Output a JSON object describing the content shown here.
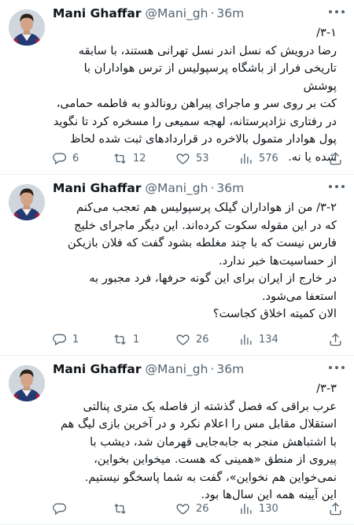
{
  "tweets": [
    {
      "author_name": "Mani Ghaffar",
      "handle": "@Mani_gh",
      "separator": "·",
      "time": "36m",
      "text": "۳-۱/\nرضا درویش که نسل اندر نسل تهرانی هستند، با سابقه\nتاریخی فرار از باشگاه پرسپولیس از ترس هواداران با پوشش\nکت بر روی سر و ماجرای پیراهن رونالدو به فاطمه حمامی،\nدر رفتاری نژادپرستانه، لهجه سمیعی را مسخره کرد تا نگوید\nپول هوادار متمول بالاخره در قراردادهای ثبت شده لحاظ\nشده یا نه.",
      "replies": "6",
      "retweets": "12",
      "likes": "53",
      "views": "576"
    },
    {
      "author_name": "Mani Ghaffar",
      "handle": "@Mani_gh",
      "separator": "·",
      "time": "36m",
      "text": "۳-۲/ من از هواداران گیلک پرسپولیس هم تعجب می‌کنم\nکه در این مقوله سکوت کرده‌اند. این دیگر ماجرای خلیج\nفارس نیست که با چند مغلطه بشود گفت که فلان بازیکن\nاز حساسیت‌ها خبر ندارد.\nدر خارج از ایران برای این گونه حرفها، فرد مجبور به\nاستعفا می‌شود.\nالان کمیته اخلاق کجاست؟",
      "replies": "1",
      "retweets": "1",
      "likes": "26",
      "views": "134"
    },
    {
      "author_name": "Mani Ghaffar",
      "handle": "@Mani_gh",
      "separator": "·",
      "time": "36m",
      "text": "۳-۳/\nعرب براقی که فصل گذشته از فاصله یک متری پنالتی\nاستقلال مقابل مس را اعلام نکرد و در آخرین بازی لیگ هم\nبا اشتباهش منجر به جابه‌جایی قهرمان شد، دیشب با\nپیروی از منطق «همینی که هست. میخواین بخواین،\nنمی‌خواین هم نخواین»، گفت به شما پاسخگو نیستیم.\nاین آیینه همه این سال‌ها بود.",
      "replies": "",
      "retweets": "",
      "likes": "26",
      "views": "130"
    }
  ],
  "icons": {
    "avatar": "avatar-photo",
    "more": "more-horizontal-icon",
    "reply": "reply-icon",
    "retweet": "retweet-icon",
    "like": "heart-icon",
    "views": "views-chart-icon",
    "share": "share-icon"
  },
  "colors": {
    "text_primary": "#0f1419",
    "text_secondary": "#536471",
    "divider": "#eff3f4"
  }
}
